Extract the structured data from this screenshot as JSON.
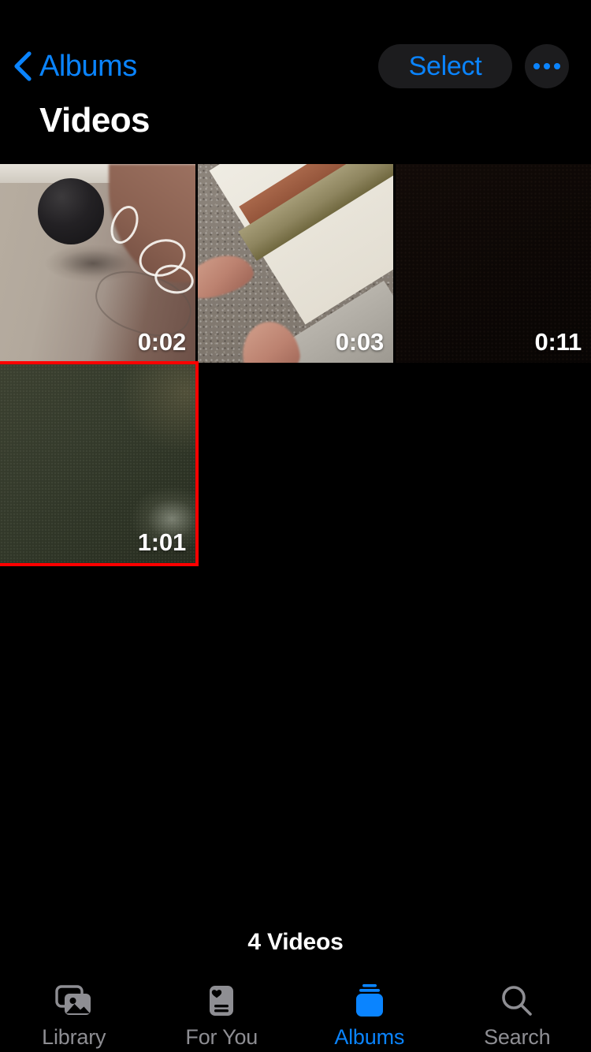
{
  "navbar": {
    "back_icon": "chevron-left-icon",
    "back_label": "Albums",
    "select_label": "Select",
    "more_icon": "ellipsis-icon",
    "accent_color": "#0a84ff",
    "button_bg": "#1c1c1e"
  },
  "page_title": "Videos",
  "grid": {
    "columns": 3,
    "selection_color": "#ff0000",
    "items": [
      {
        "index": 1,
        "duration": "0:02",
        "description": "dark spherical smart speaker on a light tiled floor with a coiled white cable",
        "art": "art-speaker",
        "selected": false
      },
      {
        "index": 2,
        "duration": "0:03",
        "description": "grey speckled carpet meeting a wooden threshold strip with fingers at lower left",
        "art": "art-carpet",
        "selected": false
      },
      {
        "index": 3,
        "duration": "0:11",
        "description": "almost entirely black frame",
        "art": "art-dark",
        "selected": false
      },
      {
        "index": 4,
        "duration": "1:01",
        "description": "dark olive green frame with a pale glow in the lower right corner",
        "art": "art-olive",
        "selected": true
      }
    ]
  },
  "footer": {
    "count_label": "4 Videos"
  },
  "tabbar": {
    "active_color": "#0a84ff",
    "inactive_color": "#8e8e93",
    "tabs": [
      {
        "id": "library",
        "label": "Library",
        "icon": "photo-stack-icon",
        "active": false
      },
      {
        "id": "for-you",
        "label": "For You",
        "icon": "memories-card-icon",
        "active": false
      },
      {
        "id": "albums",
        "label": "Albums",
        "icon": "albums-stack-icon",
        "active": true
      },
      {
        "id": "search",
        "label": "Search",
        "icon": "search-icon",
        "active": false
      }
    ]
  }
}
